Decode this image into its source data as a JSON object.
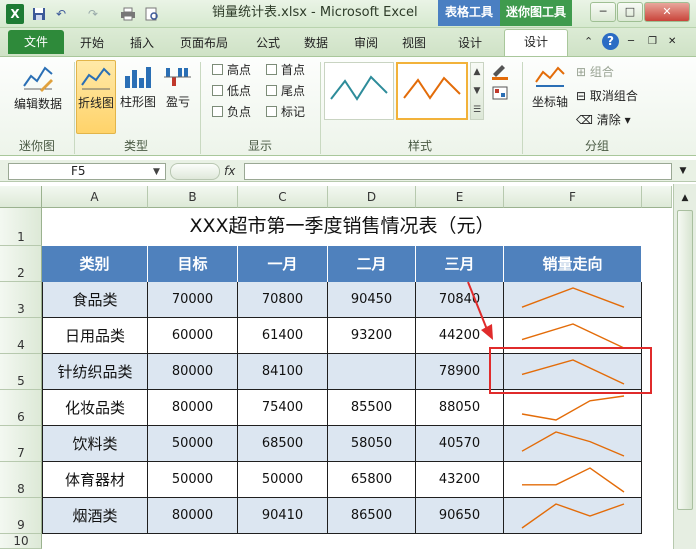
{
  "window": {
    "title": "销量统计表.xlsx - Microsoft Excel",
    "context_groups": [
      "表格工具",
      "迷你图工具"
    ],
    "controls": {
      "minimize": "─",
      "restore": "□",
      "close": "✕"
    }
  },
  "quick_access": {
    "excel_icon": "X",
    "undo": "↶",
    "redo": "↷"
  },
  "tabs": [
    "文件",
    "开始",
    "插入",
    "页面布局",
    "公式",
    "数据",
    "审阅",
    "视图",
    "设计",
    "设计"
  ],
  "ribbon": {
    "groups": {
      "sparkline": "迷你图",
      "type": "类型",
      "show": "显示",
      "style": "样式",
      "group": "分组"
    },
    "edit_data": "编辑数据",
    "type_buttons": [
      "折线图",
      "柱形图",
      "盈亏"
    ],
    "show_checks": [
      "高点",
      "首点",
      "低点",
      "尾点",
      "负点",
      "标记"
    ],
    "axis": "坐标轴",
    "group_btns": [
      "组合",
      "取消组合",
      "清除"
    ]
  },
  "formula_bar": {
    "cell_ref": "F5",
    "fx": "fx",
    "value": ""
  },
  "columns": [
    "A",
    "B",
    "C",
    "D",
    "E",
    "F"
  ],
  "rows": [
    "1",
    "2",
    "3",
    "4",
    "5",
    "6",
    "7",
    "8",
    "9",
    "10"
  ],
  "sheet": {
    "title": "XXX超市第一季度销售情况表（元）",
    "headers": [
      "类别",
      "目标",
      "一月",
      "二月",
      "三月",
      "销量走向"
    ],
    "data": [
      {
        "cat": "食品类",
        "target": "70000",
        "jan": "70800",
        "feb": "90450",
        "mar": "70840",
        "spark": [
          0.2,
          1.0,
          0.2
        ]
      },
      {
        "cat": "日用品类",
        "target": "60000",
        "jan": "61400",
        "feb": "93200",
        "mar": "44200",
        "spark": [
          0.35,
          1.0,
          0.0
        ]
      },
      {
        "cat": "针纺织品类",
        "target": "80000",
        "jan": "84100",
        "feb": "",
        "mar": "78900",
        "spark": [
          0.4,
          1.0,
          0.0
        ]
      },
      {
        "cat": "化妆品类",
        "target": "80000",
        "jan": "75400",
        "feb": "85500",
        "mar": "88050",
        "spark": [
          0.25,
          0.0,
          0.8,
          1.0
        ]
      },
      {
        "cat": "饮料类",
        "target": "50000",
        "jan": "68500",
        "feb": "58050",
        "mar": "40570",
        "spark": [
          0.2,
          1.0,
          0.6,
          0.0
        ]
      },
      {
        "cat": "体育器材",
        "target": "50000",
        "jan": "50000",
        "feb": "65800",
        "mar": "43200",
        "spark": [
          0.3,
          0.3,
          1.0,
          0.0
        ]
      },
      {
        "cat": "烟酒类",
        "target": "80000",
        "jan": "90410",
        "feb": "86500",
        "mar": "90650",
        "spark": [
          0.0,
          1.0,
          0.5,
          1.0
        ]
      }
    ]
  },
  "colors": {
    "header_blue": "#4f81bd",
    "row_light": "#dce6f1",
    "spark_orange": "#e36c09",
    "highlight_red": "#e02b2b",
    "file_green": "#2e8a3a"
  }
}
